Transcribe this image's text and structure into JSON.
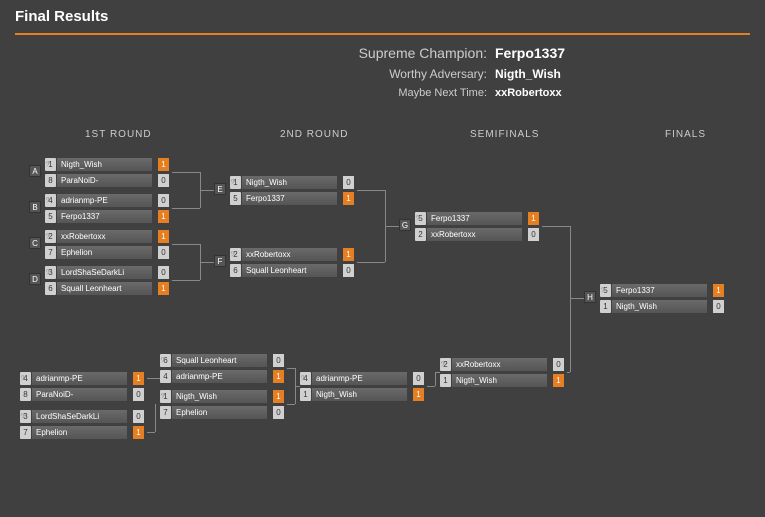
{
  "title": "Final Results",
  "results": {
    "champ_lbl": "Supreme Champion:",
    "champ_val": "Ferpo1337",
    "adv_lbl": "Worthy Adversary:",
    "adv_val": "Nigth_Wish",
    "third_lbl": "Maybe Next Time:",
    "third_val": "xxRobertoxx"
  },
  "rh": {
    "r1": "1ST ROUND",
    "r2": "2ND ROUND",
    "sf": "SEMIFINALS",
    "f": "FINALS"
  },
  "m": {
    "A": {
      "l": "A",
      "p1s": "1",
      "p1n": "Nigth_Wish",
      "p1r": "1",
      "p2s": "8",
      "p2n": "ParaNoiD-",
      "p2r": "0"
    },
    "B": {
      "l": "B",
      "p1s": "4",
      "p1n": "adrianmp-PE",
      "p1r": "0",
      "p2s": "5",
      "p2n": "Ferpo1337",
      "p2r": "1"
    },
    "C": {
      "l": "C",
      "p1s": "2",
      "p1n": "xxRobertoxx",
      "p1r": "1",
      "p2s": "7",
      "p2n": "Ephelion",
      "p2r": "0"
    },
    "D": {
      "l": "D",
      "p1s": "3",
      "p1n": "LordShaSeDarkLi",
      "p1r": "0",
      "p2s": "6",
      "p2n": "Squall Leonheart",
      "p2r": "1"
    },
    "E": {
      "l": "E",
      "p1s": "1",
      "p1n": "Nigth_Wish",
      "p1r": "0",
      "p2s": "5",
      "p2n": "Ferpo1337",
      "p2r": "1"
    },
    "F": {
      "l": "F",
      "p1s": "2",
      "p1n": "xxRobertoxx",
      "p1r": "1",
      "p2s": "6",
      "p2n": "Squall Leonheart",
      "p2r": "0"
    },
    "G": {
      "l": "G",
      "p1s": "5",
      "p1n": "Ferpo1337",
      "p1r": "1",
      "p2s": "2",
      "p2n": "xxRobertoxx",
      "p2r": "0"
    },
    "H": {
      "l": "H",
      "p1s": "5",
      "p1n": "Ferpo1337",
      "p1r": "1",
      "p2s": "1",
      "p2n": "Nigth_Wish",
      "p2r": "0"
    },
    "L1": {
      "p1s": "4",
      "p1n": "adrianmp-PE",
      "p1r": "1",
      "p2s": "8",
      "p2n": "ParaNoiD-",
      "p2r": "0"
    },
    "L2": {
      "p1s": "3",
      "p1n": "LordShaSeDarkLi",
      "p1r": "0",
      "p2s": "7",
      "p2n": "Ephelion",
      "p2r": "1"
    },
    "L3": {
      "p1s": "6",
      "p1n": "Squall Leonheart",
      "p1r": "0",
      "p2s": "4",
      "p2n": "adrianmp-PE",
      "p2r": "1"
    },
    "L4": {
      "p1s": "1",
      "p1n": "Nigth_Wish",
      "p1r": "1",
      "p2s": "7",
      "p2n": "Ephelion",
      "p2r": "0"
    },
    "L5": {
      "p1s": "4",
      "p1n": "adrianmp-PE",
      "p1r": "0",
      "p2s": "1",
      "p2n": "Nigth_Wish",
      "p2r": "1"
    },
    "L6": {
      "p1s": "2",
      "p1n": "xxRobertoxx",
      "p1r": "0",
      "p2s": "1",
      "p2n": "Nigth_Wish",
      "p2r": "1"
    }
  }
}
